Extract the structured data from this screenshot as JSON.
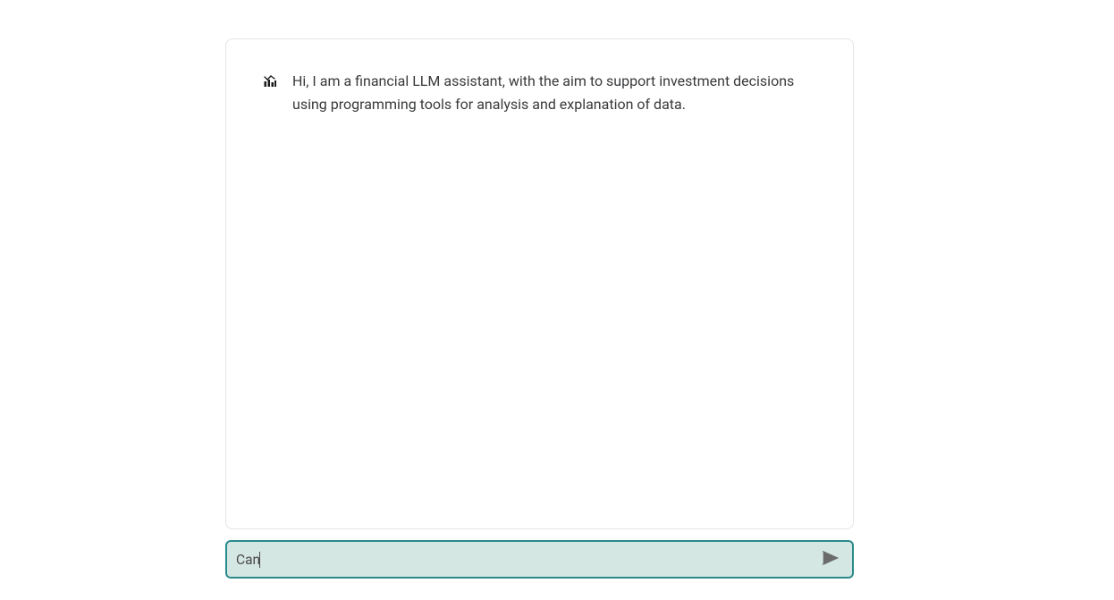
{
  "chat": {
    "messages": [
      {
        "role": "assistant",
        "text": "Hi, I am a financial LLM assistant, with the aim to support investment decisions using programming tools for analysis and explanation of data."
      }
    ]
  },
  "input": {
    "value": "Can",
    "placeholder": ""
  },
  "icons": {
    "avatar": "bar-chart-icon",
    "send": "send-icon"
  }
}
